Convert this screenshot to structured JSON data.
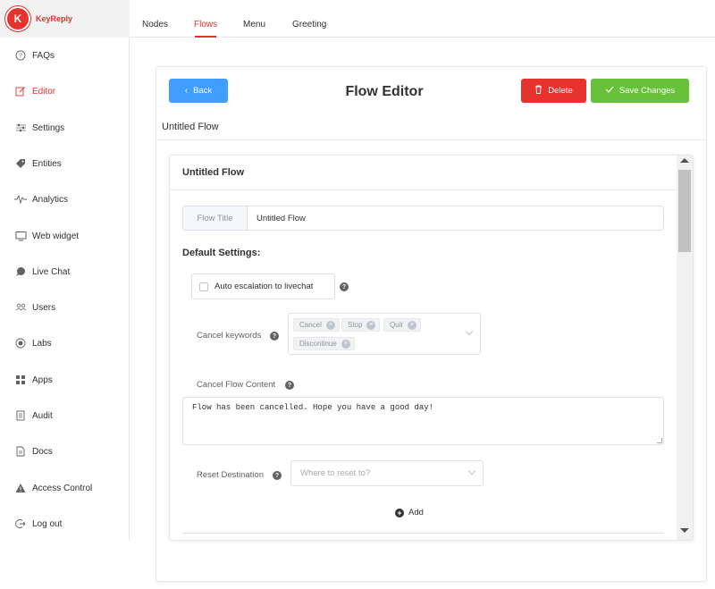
{
  "brand": {
    "name": "KeyReply",
    "logo_letter": "K",
    "color": "#e8322e"
  },
  "sidebar": {
    "items": [
      {
        "label": "FAQs",
        "icon": "question-circle-icon"
      },
      {
        "label": "Editor",
        "icon": "edit-icon"
      },
      {
        "label": "Settings",
        "icon": "sliders-icon"
      },
      {
        "label": "Entities",
        "icon": "tag-icon"
      },
      {
        "label": "Analytics",
        "icon": "pulse-icon"
      },
      {
        "label": "Web widget",
        "icon": "monitor-icon"
      },
      {
        "label": "Live Chat",
        "icon": "chat-bubble-icon"
      },
      {
        "label": "Users",
        "icon": "users-icon"
      },
      {
        "label": "Labs",
        "icon": "record-icon"
      },
      {
        "label": "Apps",
        "icon": "grid-icon"
      },
      {
        "label": "Audit",
        "icon": "document-list-icon"
      },
      {
        "label": "Docs",
        "icon": "document-icon"
      },
      {
        "label": "Access Control",
        "icon": "warning-icon"
      },
      {
        "label": "Log out",
        "icon": "logout-icon"
      }
    ],
    "active": "Editor"
  },
  "tabs": [
    {
      "label": "Nodes"
    },
    {
      "label": "Flows"
    },
    {
      "label": "Menu"
    },
    {
      "label": "Greeting"
    }
  ],
  "active_tab": "Flows",
  "header": {
    "back_label": "Back",
    "title": "Flow Editor",
    "delete_label": "Delete",
    "save_label": "Save Changes"
  },
  "flow_name": "Untitled Flow",
  "panel": {
    "title": "Untitled Flow",
    "flow_title_label": "Flow Title",
    "flow_title_value": "Untitled Flow",
    "default_settings_label": "Default Settings:",
    "auto_escalation_label": "Auto escalation to livechat",
    "auto_escalation_checked": false,
    "cancel_keywords_label": "Cancel keywords",
    "cancel_keywords": [
      "Cancel",
      "Stop",
      "Quit",
      "Discontinue"
    ],
    "cancel_flow_content_label": "Cancel Flow Content",
    "cancel_flow_content_value": "Flow has been cancelled. Hope you have a good day!",
    "reset_destination_label": "Reset Destination",
    "reset_destination_placeholder": "Where to reset to?",
    "add_label": "Add"
  },
  "colors": {
    "primary": "#409eff",
    "danger": "#e8322e",
    "success": "#67c23a",
    "active_red": "#e8322e"
  }
}
